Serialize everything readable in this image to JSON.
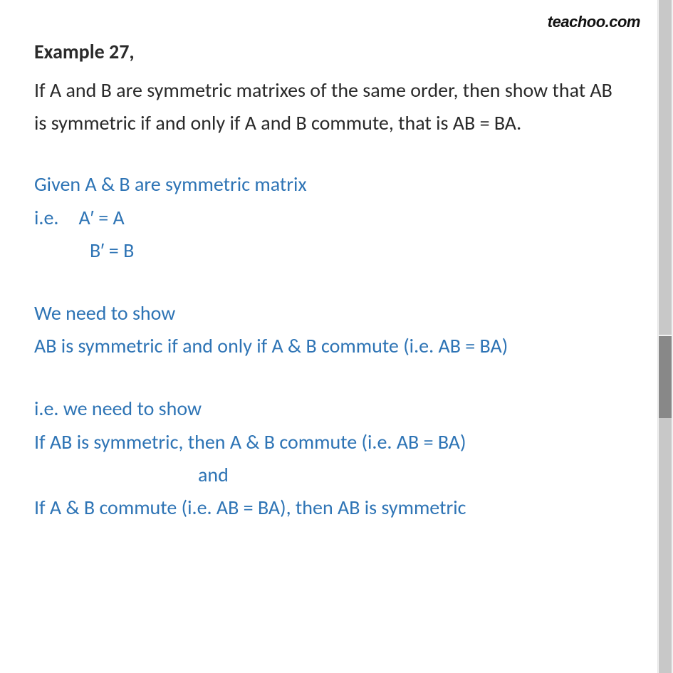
{
  "watermark": "teachoo.com",
  "heading": "Example 27,",
  "problem": "If A and B are symmetric matrixes of the same order, then show that AB is symmetric if and only if A and B commute, that is AB = BA.",
  "solution": {
    "given_title": "Given A & B are symmetric matrix",
    "given_eq1": "i.e. A′ = A",
    "given_eq2": "B′ = B",
    "need_title": "We need to show",
    "need_line": "AB is symmetric if and only if A & B commute (i.e. AB = BA)",
    "ie_need": "i.e. we need to show",
    "part1": "If AB is symmetric, then A & B commute (i.e. AB = BA)",
    "and": "and",
    "part2": "If A & B commute (i.e. AB = BA), then AB is symmetric"
  }
}
